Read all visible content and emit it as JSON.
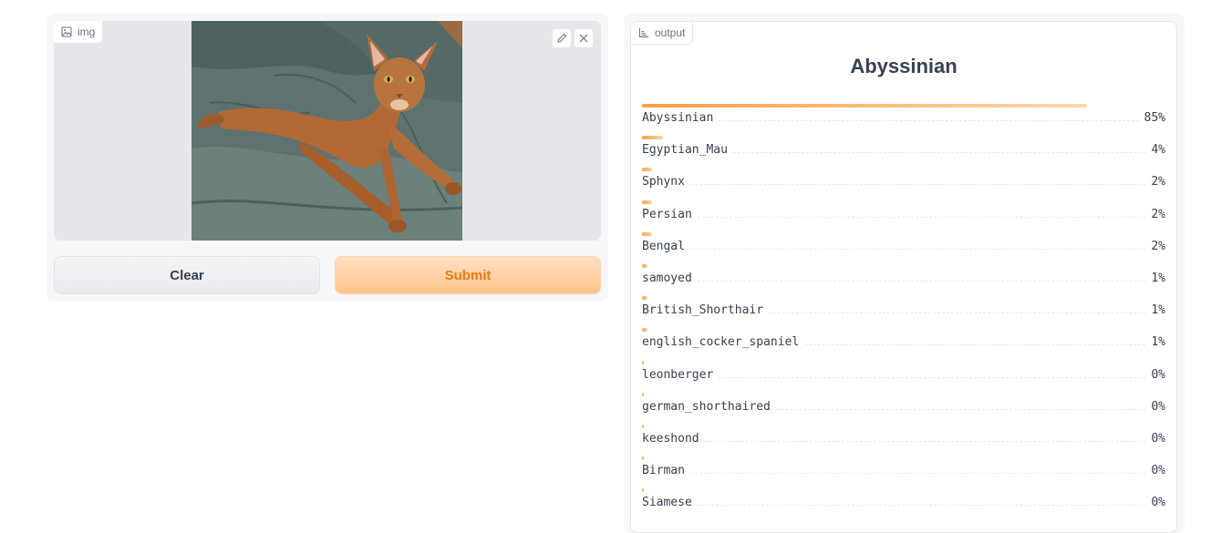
{
  "input": {
    "label": "img",
    "image_icon": "image-icon",
    "edit_icon": "pencil-icon",
    "clear_icon": "close-icon"
  },
  "buttons": {
    "clear_label": "Clear",
    "submit_label": "Submit"
  },
  "output": {
    "label": "output",
    "icon": "bar-chart-icon",
    "top_label": "Abyssinian",
    "confidences": [
      {
        "label": "Abyssinian",
        "pct": "85%",
        "value": 0.85
      },
      {
        "label": "Egyptian_Mau",
        "pct": "4%",
        "value": 0.04
      },
      {
        "label": "Sphynx",
        "pct": "2%",
        "value": 0.02
      },
      {
        "label": "Persian",
        "pct": "2%",
        "value": 0.02
      },
      {
        "label": "Bengal",
        "pct": "2%",
        "value": 0.02
      },
      {
        "label": "samoyed",
        "pct": "1%",
        "value": 0.01
      },
      {
        "label": "British_Shorthair",
        "pct": "1%",
        "value": 0.01
      },
      {
        "label": "english_cocker_spaniel",
        "pct": "1%",
        "value": 0.01
      },
      {
        "label": "leonberger",
        "pct": "0%",
        "value": 0.004
      },
      {
        "label": "german_shorthaired",
        "pct": "0%",
        "value": 0.004
      },
      {
        "label": "keeshond",
        "pct": "0%",
        "value": 0.004
      },
      {
        "label": "Birman",
        "pct": "0%",
        "value": 0.004
      },
      {
        "label": "Siamese",
        "pct": "0%",
        "value": 0.004
      }
    ]
  },
  "colors": {
    "accent": "#f59f47",
    "submit_text": "#ea7b16"
  }
}
